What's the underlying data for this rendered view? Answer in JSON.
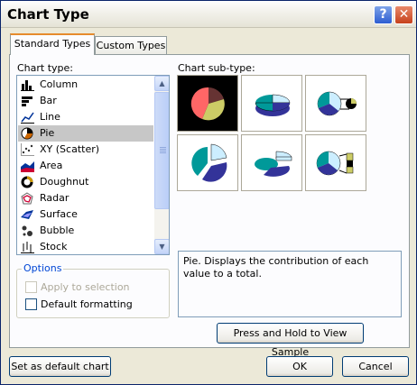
{
  "window": {
    "title": "Chart Type",
    "help_glyph": "?",
    "close_glyph": "✕"
  },
  "tabs": [
    {
      "label": "Standard Types",
      "selected": true
    },
    {
      "label": "Custom Types",
      "selected": false
    }
  ],
  "chart_type": {
    "label": "Chart type:",
    "items": [
      {
        "label": "Column",
        "icon": "column-chart-icon"
      },
      {
        "label": "Bar",
        "icon": "bar-chart-icon"
      },
      {
        "label": "Line",
        "icon": "line-chart-icon"
      },
      {
        "label": "Pie",
        "icon": "pie-chart-icon",
        "selected": true
      },
      {
        "label": "XY (Scatter)",
        "icon": "scatter-chart-icon"
      },
      {
        "label": "Area",
        "icon": "area-chart-icon"
      },
      {
        "label": "Doughnut",
        "icon": "doughnut-chart-icon"
      },
      {
        "label": "Radar",
        "icon": "radar-chart-icon"
      },
      {
        "label": "Surface",
        "icon": "surface-chart-icon"
      },
      {
        "label": "Bubble",
        "icon": "bubble-chart-icon"
      },
      {
        "label": "Stock",
        "icon": "stock-chart-icon"
      }
    ]
  },
  "chart_subtype": {
    "label": "Chart sub-type:",
    "items": [
      {
        "icon": "pie-subtype-icon",
        "selected": true
      },
      {
        "icon": "pie-3d-subtype-icon"
      },
      {
        "icon": "pie-of-pie-subtype-icon"
      },
      {
        "icon": "exploded-pie-subtype-icon"
      },
      {
        "icon": "exploded-pie-3d-subtype-icon"
      },
      {
        "icon": "bar-of-pie-subtype-icon"
      }
    ]
  },
  "options": {
    "label": "Options",
    "apply_to_selection": {
      "label": "Apply to selection",
      "checked": false,
      "disabled": true
    },
    "default_formatting": {
      "label": "Default formatting",
      "checked": false
    }
  },
  "description": "Pie. Displays the contribution of each value to a total.",
  "buttons": {
    "press_hold": "Press and Hold to View Sample",
    "set_default": "Set as default chart",
    "ok": "OK",
    "cancel": "Cancel"
  },
  "colors": {
    "pie_teal": "#009999",
    "pie_navy": "#333399",
    "pie_light": "#cceeff",
    "pie_red": "#ff6666",
    "pie_olive": "#cccc66",
    "pie_maroon": "#663333"
  }
}
